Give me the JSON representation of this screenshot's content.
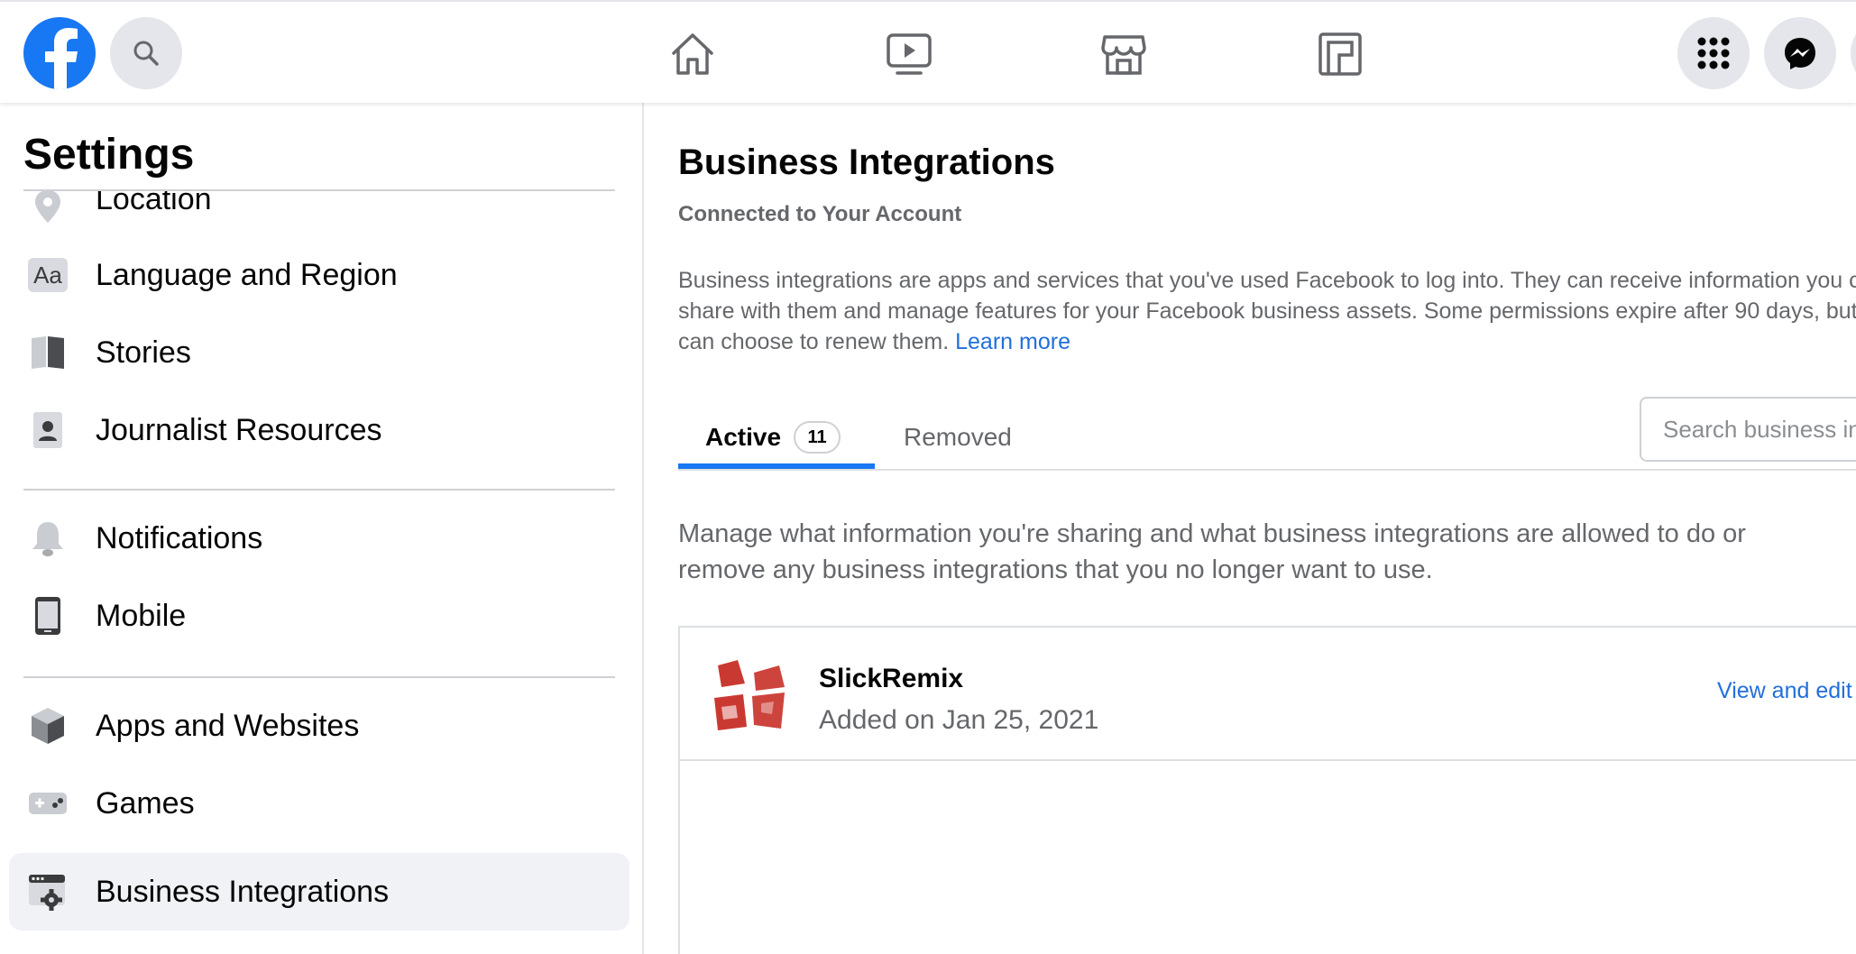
{
  "topbar": {
    "logo_letter": "f",
    "nav_icons": [
      "home-icon",
      "watch-icon",
      "marketplace-icon",
      "gaming-icon"
    ],
    "right_icons": [
      "menu-grid-icon",
      "messenger-icon"
    ]
  },
  "sidebar": {
    "title": "Settings",
    "items": [
      {
        "label": "Location",
        "icon": "location-pin-icon"
      },
      {
        "label": "Language and Region",
        "icon": "language-icon",
        "icon_text": "Aa"
      },
      {
        "label": "Stories",
        "icon": "stories-book-icon"
      },
      {
        "label": "Journalist Resources",
        "icon": "journalist-badge-icon"
      },
      {
        "label": "Notifications",
        "icon": "bell-icon"
      },
      {
        "label": "Mobile",
        "icon": "mobile-phone-icon"
      },
      {
        "label": "Apps and Websites",
        "icon": "cube-icon"
      },
      {
        "label": "Games",
        "icon": "gamepad-icon"
      },
      {
        "label": "Business Integrations",
        "icon": "business-gear-icon",
        "active": true
      }
    ]
  },
  "main": {
    "title": "Business Integrations",
    "subtitle": "Connected to Your Account",
    "description": "Business integrations are apps and services that you've used Facebook to log into. They can receive information you chose to share with them and manage features for your Facebook business assets. Some permissions expire after 90 days, but you can choose to renew them.",
    "learn_more": "Learn more",
    "tabs": [
      {
        "label": "Active",
        "count": "11",
        "active": true
      },
      {
        "label": "Removed",
        "active": false
      }
    ],
    "search_placeholder": "Search business integrations",
    "manage_text": "Manage what information you're sharing and what business integrations are allowed to do or remove any business integrations that you no longer want to use.",
    "integrations": [
      {
        "name": "SlickRemix",
        "added": "Added on Jan 25, 2021",
        "action": "View and edit"
      }
    ]
  },
  "colors": {
    "brand_blue": "#1877f2",
    "link_blue": "#216fdb",
    "secondary_text": "#65676b",
    "active_bg": "#f0f2f5",
    "slickremix_red": "#c4231b"
  }
}
